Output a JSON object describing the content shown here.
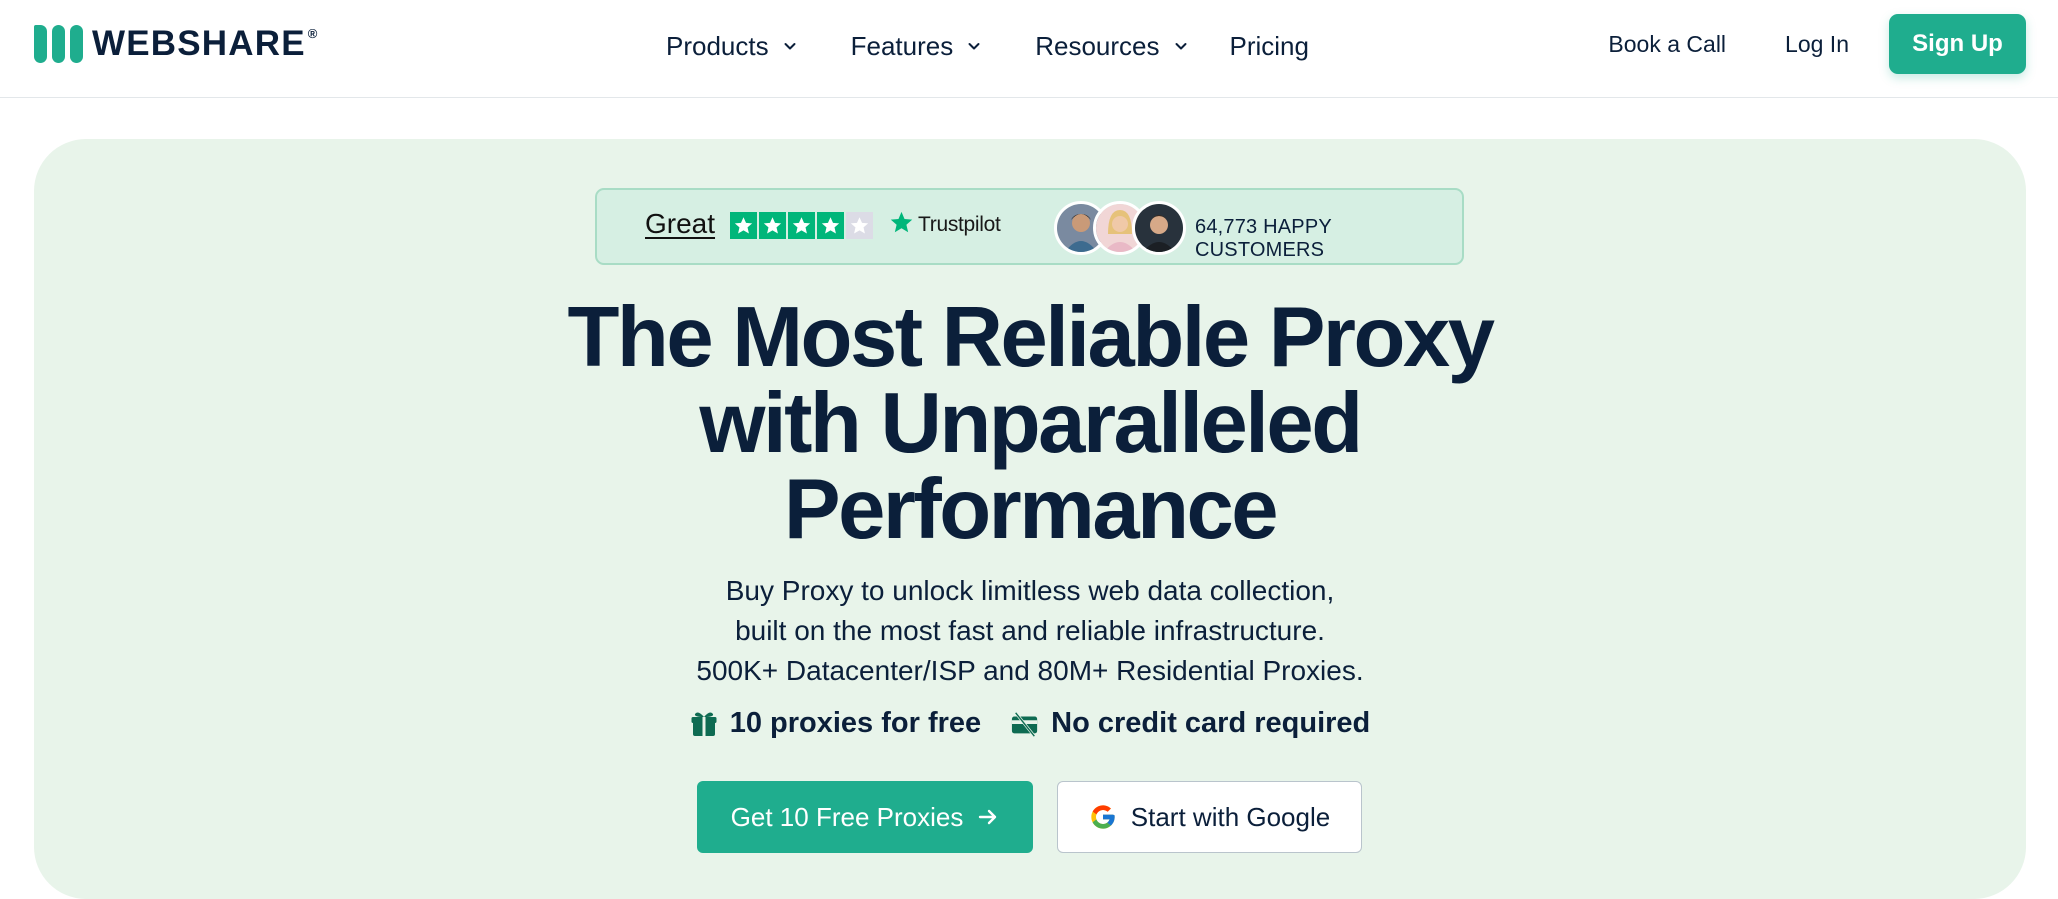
{
  "brand": {
    "name": "WEBSHARE",
    "registered": "®",
    "accent_color": "#1fad8e",
    "text_color": "#0b1f3a",
    "hero_bg": "#e8f4ea"
  },
  "nav": {
    "menu": [
      {
        "label": "Products",
        "dropdown": true
      },
      {
        "label": "Features",
        "dropdown": true
      },
      {
        "label": "Resources",
        "dropdown": true
      },
      {
        "label": "Pricing",
        "dropdown": false
      }
    ],
    "book_call": "Book a Call",
    "login": "Log In",
    "signup": "Sign Up"
  },
  "trust": {
    "rating_word": "Great",
    "stars": {
      "filled": 4,
      "total": 5
    },
    "provider": "Trustpilot",
    "customers": "64,773 HAPPY CUSTOMERS",
    "star_color": "#00b67a"
  },
  "hero": {
    "headline": [
      "The Most Reliable Proxy",
      "with Unparalleled",
      "Performance"
    ],
    "subtitle": [
      "Buy Proxy to unlock limitless web data collection,",
      "built on the most fast and reliable infrastructure.",
      "500K+ Datacenter/ISP and 80M+ Residential Proxies."
    ],
    "perks": [
      {
        "icon": "gift-icon",
        "label": "10 proxies for free"
      },
      {
        "icon": "no-credit-card-icon",
        "label": "No credit card required"
      }
    ],
    "cta_primary": "Get 10 Free Proxies",
    "cta_google": "Start with Google"
  }
}
